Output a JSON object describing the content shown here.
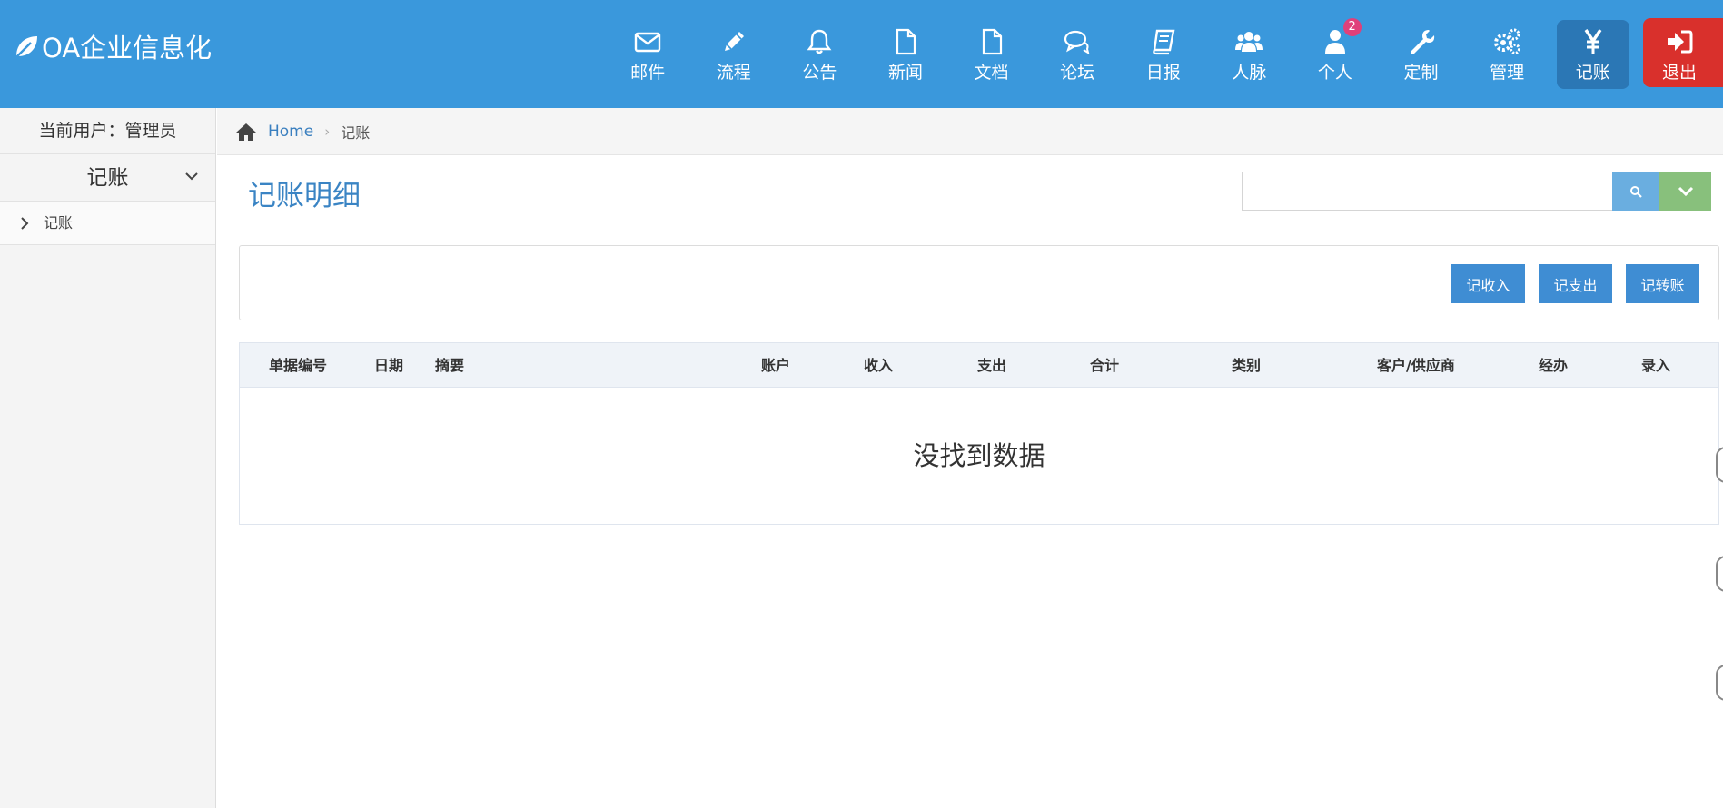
{
  "brand": {
    "title": "OA企业信息化"
  },
  "nav": {
    "items": [
      {
        "label": "邮件",
        "icon": "mail-icon"
      },
      {
        "label": "流程",
        "icon": "pencil-icon"
      },
      {
        "label": "公告",
        "icon": "bell-icon"
      },
      {
        "label": "新闻",
        "icon": "file-icon"
      },
      {
        "label": "文档",
        "icon": "document-icon"
      },
      {
        "label": "论坛",
        "icon": "chat-icon"
      },
      {
        "label": "日报",
        "icon": "book-icon"
      },
      {
        "label": "人脉",
        "icon": "users-icon"
      },
      {
        "label": "个人",
        "icon": "user-icon",
        "badge": "2"
      },
      {
        "label": "定制",
        "icon": "wrench-icon"
      },
      {
        "label": "管理",
        "icon": "gears-icon"
      },
      {
        "label": "记账",
        "icon": "yen-icon",
        "active": true
      },
      {
        "label": "退出",
        "icon": "signout-icon"
      }
    ]
  },
  "sidebar": {
    "current_user": "当前用户：管理员",
    "menu_title": "记账",
    "items": [
      {
        "label": "记账"
      }
    ]
  },
  "breadcrumb": {
    "home": "Home",
    "current": "记账"
  },
  "page": {
    "title": "记账明细",
    "search": {
      "value": "",
      "placeholder": ""
    }
  },
  "actions": {
    "income": "记收入",
    "expense": "记支出",
    "transfer": "记转账"
  },
  "table": {
    "columns": [
      "单据编号",
      "日期",
      "摘要",
      "账户",
      "收入",
      "支出",
      "合计",
      "类别",
      "客户/供应商",
      "经办",
      "录入"
    ],
    "empty_message": "没找到数据"
  },
  "colors": {
    "navbar": "#3a98dc",
    "nav_active": "#2b77b5",
    "exit": "#d9302c",
    "badge": "#e0407a",
    "button": "#3f8dd3",
    "search_button": "#6aaee0",
    "toggle_button": "#88c07c",
    "title": "#3a84c4"
  }
}
